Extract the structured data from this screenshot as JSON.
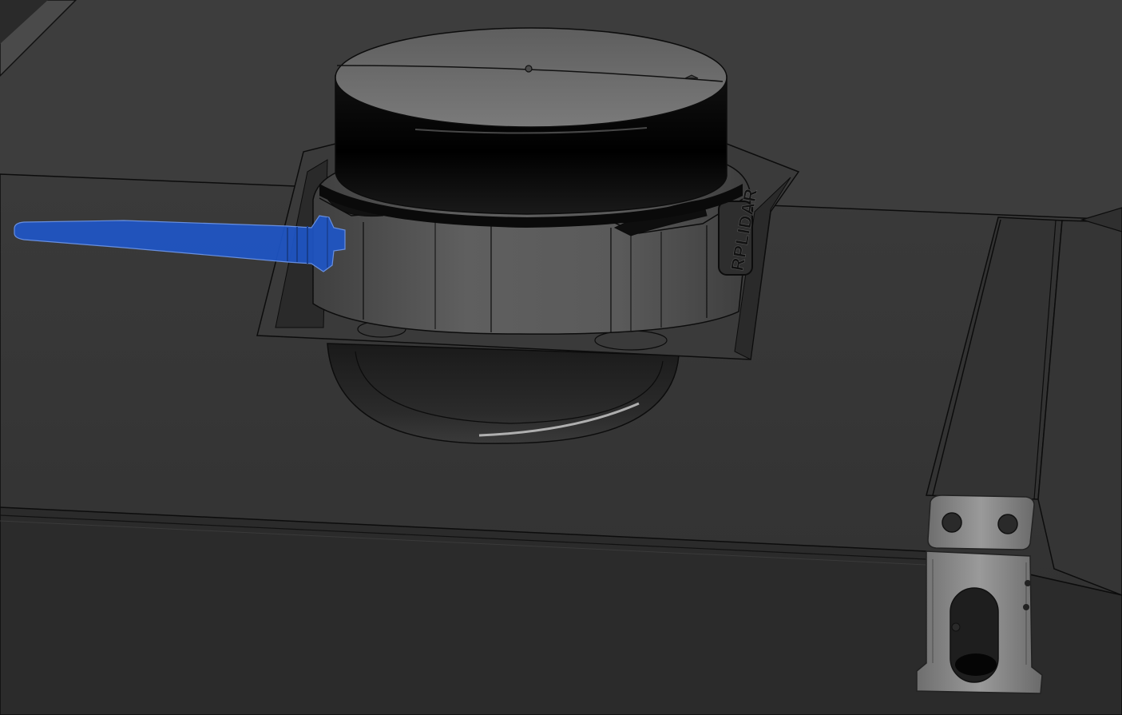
{
  "viewport": {
    "background_color": "#2f2f2f",
    "surface_color": "#303030",
    "edge_color": "#0a0a0a",
    "highlight_color": "#1f56c7"
  },
  "scene": {
    "lidar": {
      "logo_text": "RPLIDAR",
      "cap_color": "#050505",
      "top_color": "#6a6a6a",
      "housing_color": "#5b5b5b"
    },
    "selected_part": {
      "color": "#1f56c7"
    },
    "hinge": {
      "color": "#8a8a8a"
    }
  }
}
